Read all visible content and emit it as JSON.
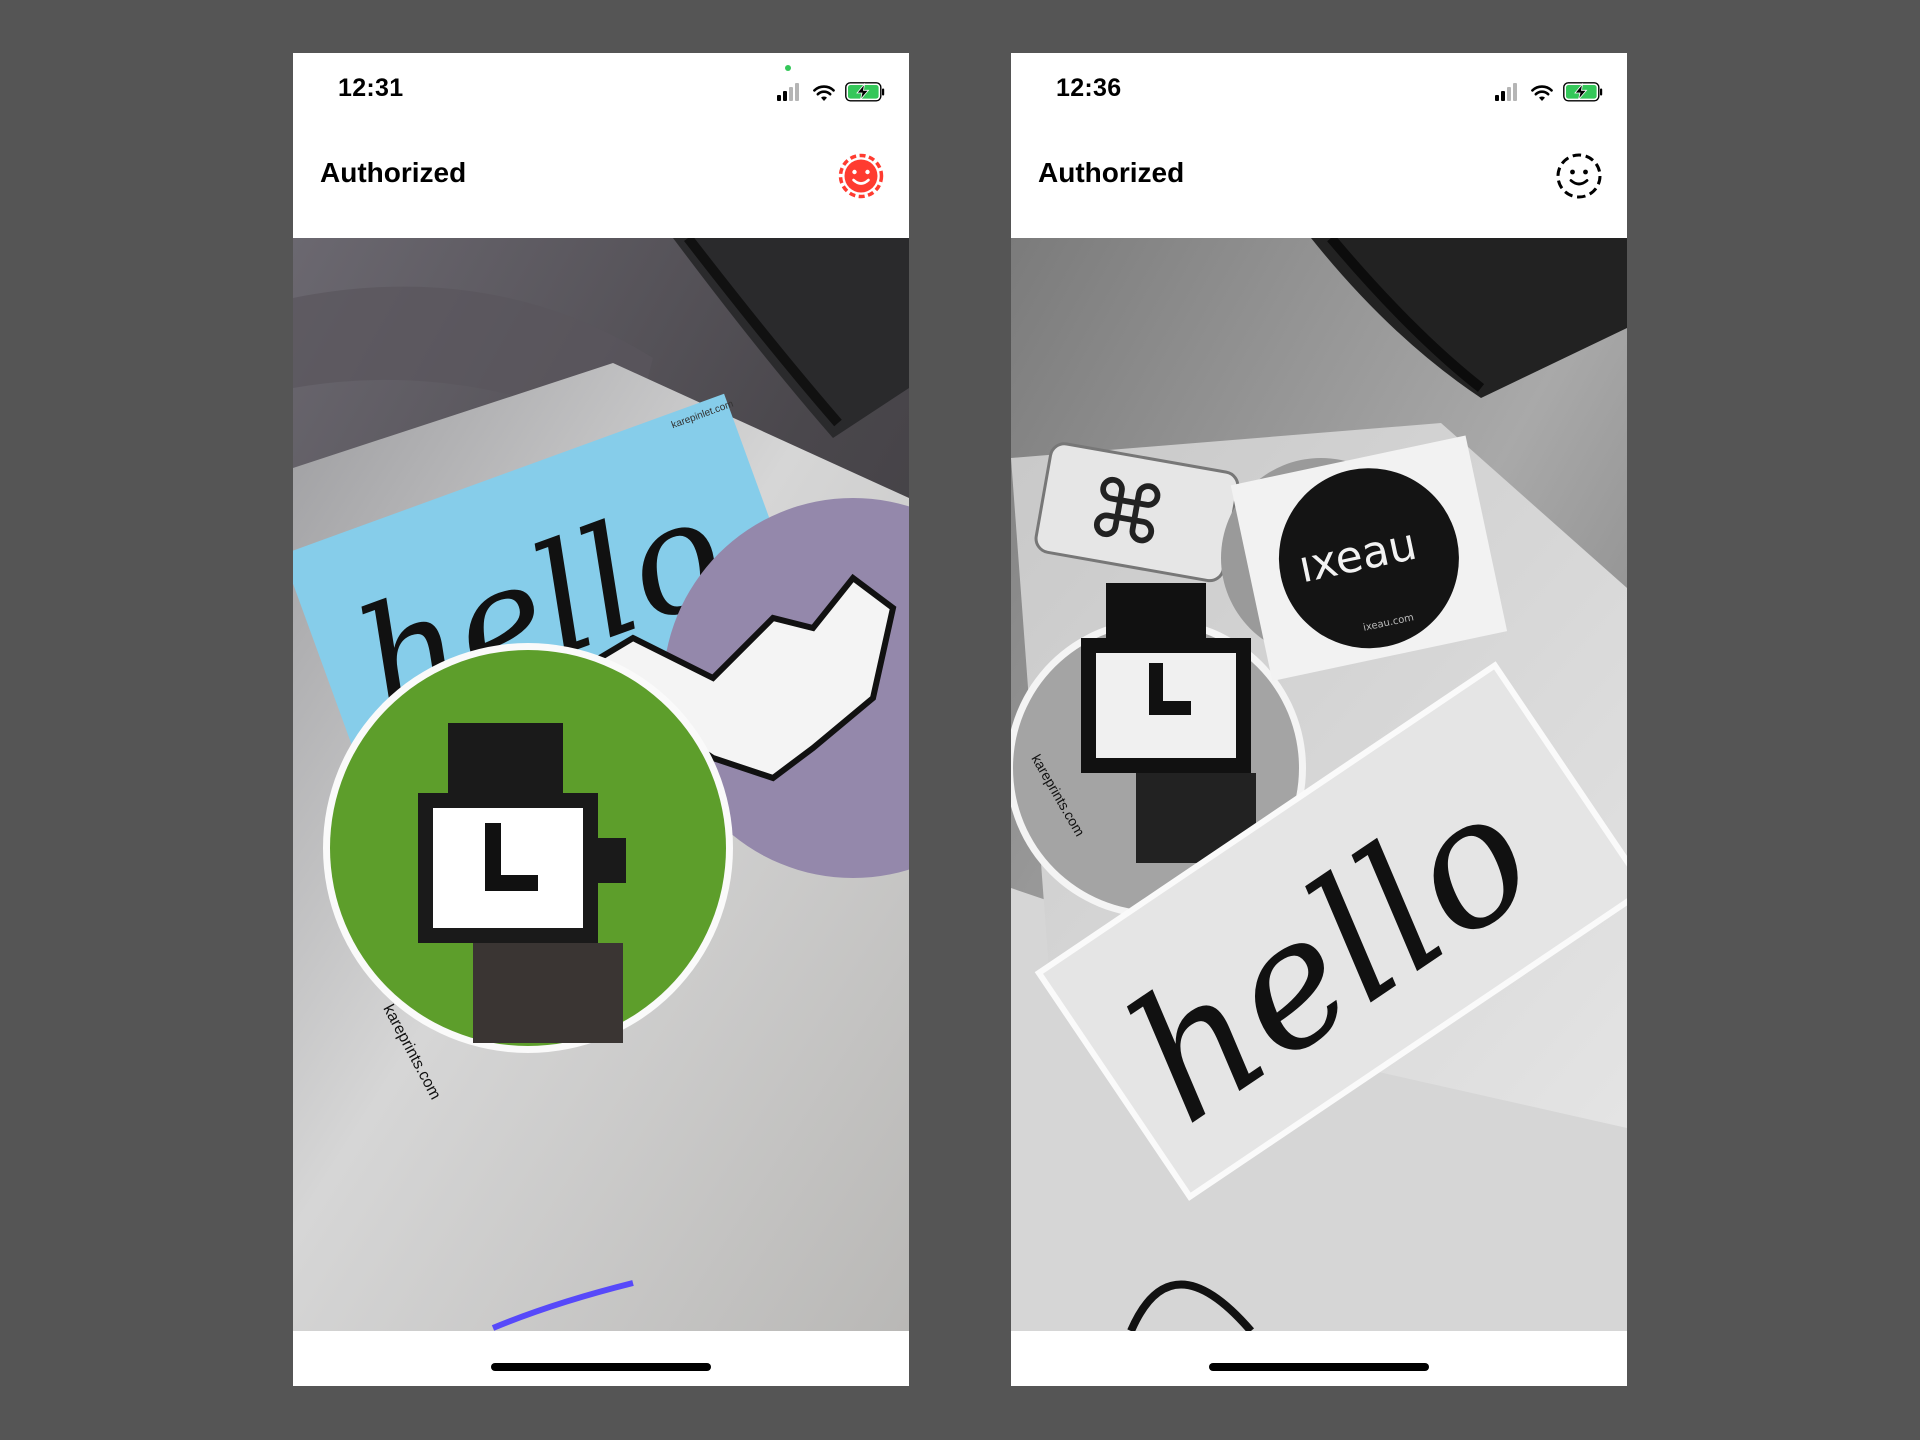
{
  "screens": [
    {
      "id": "left",
      "status_time": "12:31",
      "title": "Authorized",
      "face_icon": "face-smile-icon-filled-red",
      "face_color": "#ff3b30",
      "camera_mode": "color",
      "stickers": {
        "hello_text": "hello.",
        "small_text": "karepinlet.com",
        "url_text": "kareprints.com"
      }
    },
    {
      "id": "right",
      "status_time": "12:36",
      "title": "Authorized",
      "face_icon": "face-smile-icon-dashed-outline",
      "face_color": "#000000",
      "camera_mode": "grayscale",
      "stickers": {
        "hello_text": "hello",
        "brand_text": "ıxeau",
        "brand_url": "ixeau.com",
        "url_text": "kareprints.com"
      }
    }
  ],
  "colors": {
    "background": "#555555",
    "battery_charging": "#34c759",
    "camera_indicator": "#34c759"
  }
}
